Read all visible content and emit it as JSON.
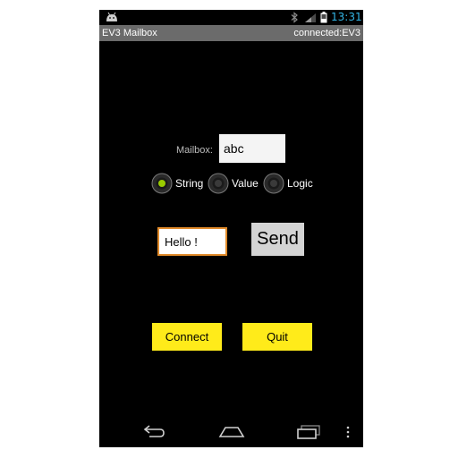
{
  "status_bar": {
    "time": "13:31",
    "icons": [
      "android-icon",
      "bluetooth-icon",
      "signal-icon",
      "battery-icon"
    ],
    "clock_color": "#33b5e5"
  },
  "app_bar": {
    "title": "EV3 Mailbox",
    "connection_status": "connected:EV3",
    "background": "#6b6b6b"
  },
  "form": {
    "mailbox_label": "Mailbox:",
    "mailbox_value": "abc",
    "type_options": [
      {
        "label": "String",
        "selected": true
      },
      {
        "label": "Value",
        "selected": false
      },
      {
        "label": "Logic",
        "selected": false
      }
    ],
    "message_value": "Hello !",
    "send_label": "Send"
  },
  "actions": {
    "connect_label": "Connect",
    "quit_label": "Quit",
    "accent": "#ffeb1a"
  },
  "nav_bar": {
    "icons": [
      "back-icon",
      "home-icon",
      "recents-icon",
      "menu-icon"
    ]
  }
}
